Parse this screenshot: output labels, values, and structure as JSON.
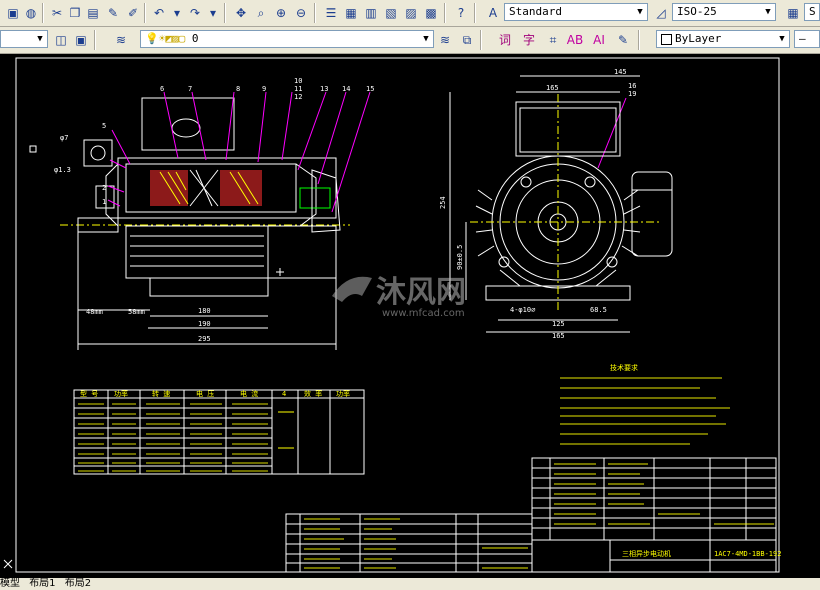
{
  "toolbar": {
    "text_style": "Standard",
    "dim_style": "ISO-25",
    "layer": "0",
    "linetype": "ByLayer",
    "right_clip": "S"
  },
  "drawing": {
    "left_numbers": [
      "6",
      "7",
      "8",
      "9",
      "10",
      "11",
      "12",
      "13",
      "14",
      "15"
    ],
    "dims_front": [
      "48mm",
      "58mm",
      "180",
      "190",
      "295"
    ],
    "dims_side_top": [
      "145",
      "165",
      "16",
      "19"
    ],
    "dims_side_bottom": [
      "4-φ10⌀",
      "68.5",
      "125",
      "165"
    ],
    "dims_side_vert": [
      "254",
      "90±0.5"
    ],
    "tech_title": "技术要求",
    "title_block": "三相异步电动机",
    "drawing_no": "1AC7-4MD-1BB-192",
    "watermark_cn": "沐风网",
    "watermark_url": "www.mfcad.com"
  },
  "left_table_headers": [
    "型 号",
    "功率",
    "转 速",
    "电 压",
    "电 流",
    "4",
    "效 率",
    "功率"
  ],
  "tabs": [
    "模型",
    "布局1",
    "布局2"
  ],
  "colors": {
    "canvas": "#000000",
    "line": "#ffffff",
    "yellow": "#ffff00",
    "magenta": "#ff00ff",
    "green": "#00ff00"
  }
}
